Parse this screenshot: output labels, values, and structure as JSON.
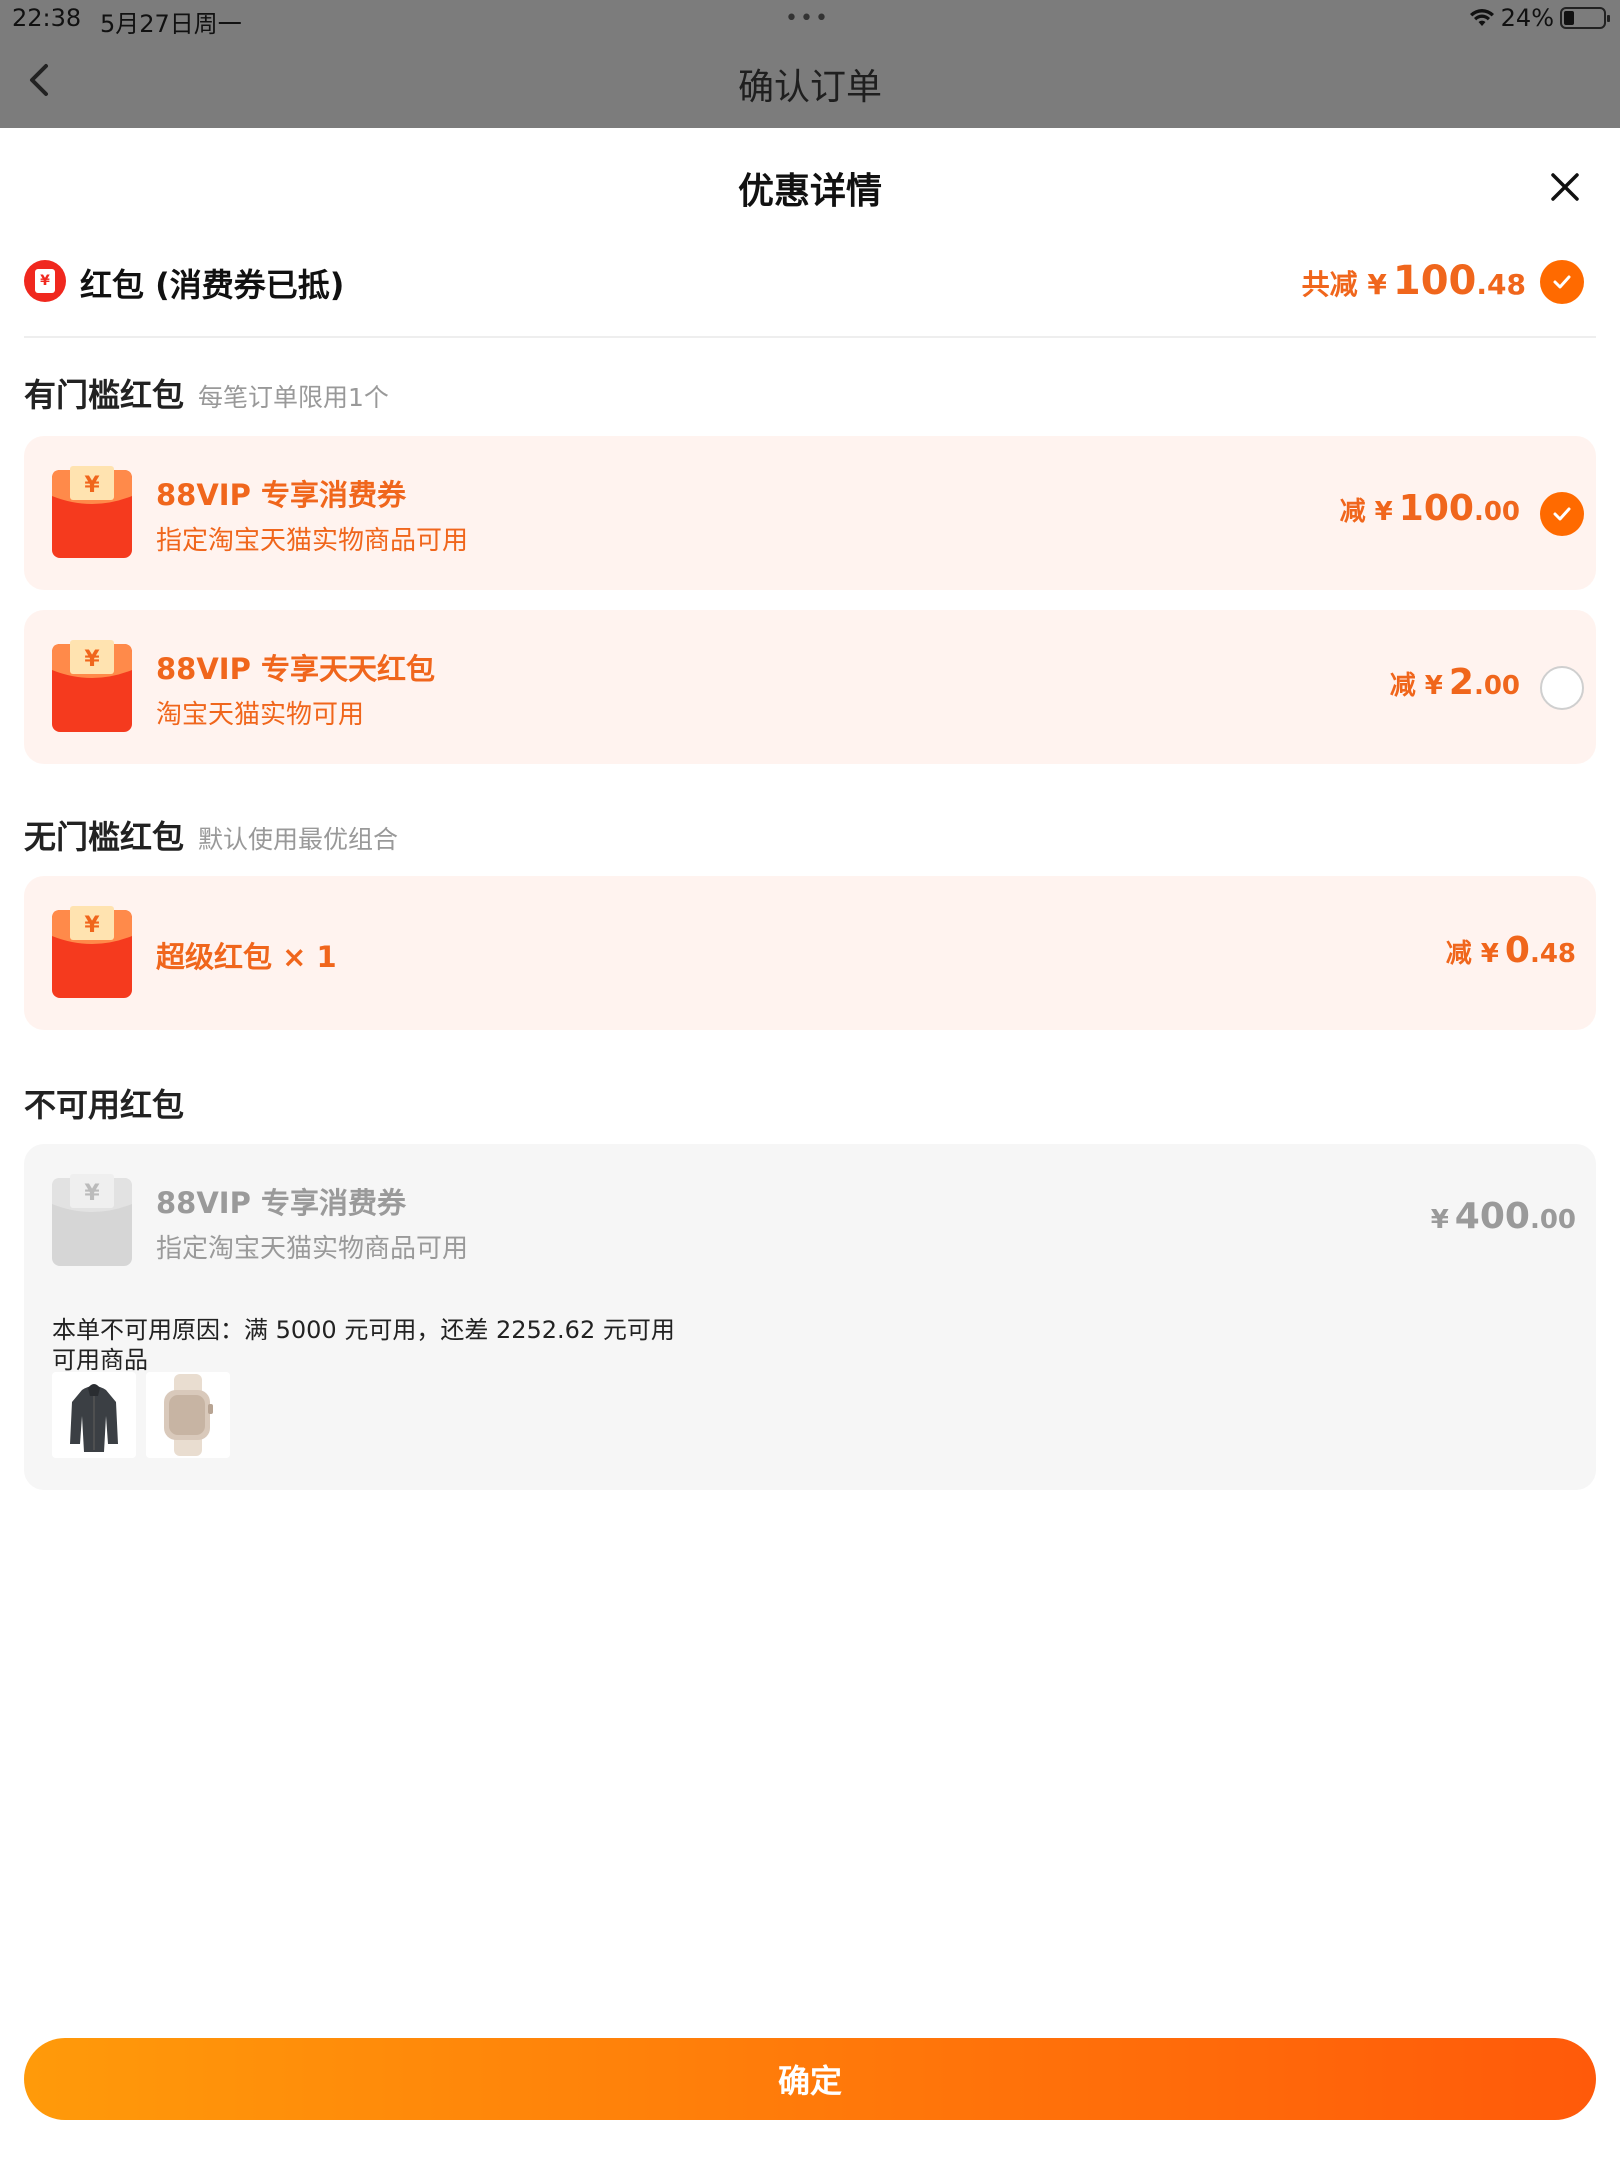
{
  "status_bar": {
    "time": "22:38",
    "date": "5月27日周一",
    "dots": "•••",
    "battery_text": "24%",
    "battery_level": 0.24
  },
  "nav": {
    "title": "确认订单"
  },
  "sheet": {
    "title": "优惠详情",
    "summary": {
      "label": "红包 (消费券已抵)",
      "prefix": "共减 ¥",
      "amount_int": "100",
      "amount_dec": ".48",
      "checked": true
    },
    "threshold_section": {
      "title": "有门槛红包",
      "subtitle": "每笔订单限用1个",
      "items": [
        {
          "title": "88VIP 专享消费券",
          "desc": "指定淘宝天猫实物商品可用",
          "prefix": "减 ¥",
          "amount_int": "100",
          "amount_dec": ".00",
          "checked": true
        },
        {
          "title": "88VIP 专享天天红包",
          "desc": "淘宝天猫实物可用",
          "prefix": "减 ¥",
          "amount_int": "2",
          "amount_dec": ".00",
          "checked": false
        }
      ]
    },
    "no_threshold_section": {
      "title": "无门槛红包",
      "subtitle": "默认使用最优组合",
      "items": [
        {
          "title": "超级红包 × 1",
          "prefix": "减 ¥",
          "amount_int": "0",
          "amount_dec": ".48"
        }
      ]
    },
    "unavailable_section": {
      "title": "不可用红包",
      "items": [
        {
          "title": "88VIP 专享消费券",
          "desc": "指定淘宝天猫实物商品可用",
          "prefix": "¥",
          "amount_int": "400",
          "amount_dec": ".00",
          "reason": "本单不可用原因：满 5000 元可用，还差 2252.62 元可用",
          "available_label": "可用商品",
          "products": [
            "jacket-product-image",
            "watch-product-image"
          ]
        }
      ]
    },
    "confirm_label": "确定"
  },
  "colors": {
    "accent": "#ff6a00",
    "discount_text": "#f0661c",
    "card_bg": "#fff3ef",
    "disabled_bg": "#f6f6f6",
    "overlay": "#7c7c7c"
  }
}
